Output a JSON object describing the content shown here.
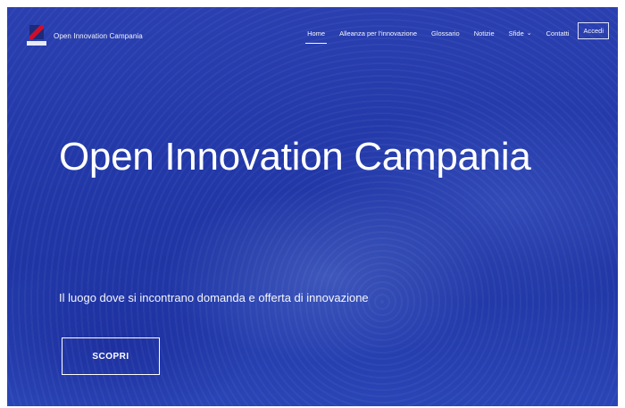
{
  "nav": {
    "brand_name": "Open Innovation Campania",
    "items": [
      {
        "label": "Home"
      },
      {
        "label": "Alleanza per l'innovazione"
      },
      {
        "label": "Glossario"
      },
      {
        "label": "Notizie"
      },
      {
        "label": "Sfide"
      },
      {
        "label": "Contatti"
      }
    ],
    "login_label": "Accedi",
    "icons": {
      "logo": "campania-shield-logo",
      "dropdown": "chevron-down-icon"
    }
  },
  "hero": {
    "title": "Open Innovation Campania",
    "subtitle": "Il luogo dove si incontrano domanda e offerta di innovazione",
    "cta_label": "SCOPRI"
  },
  "colors": {
    "hero_background": "#2238a8",
    "text": "#ffffff"
  }
}
